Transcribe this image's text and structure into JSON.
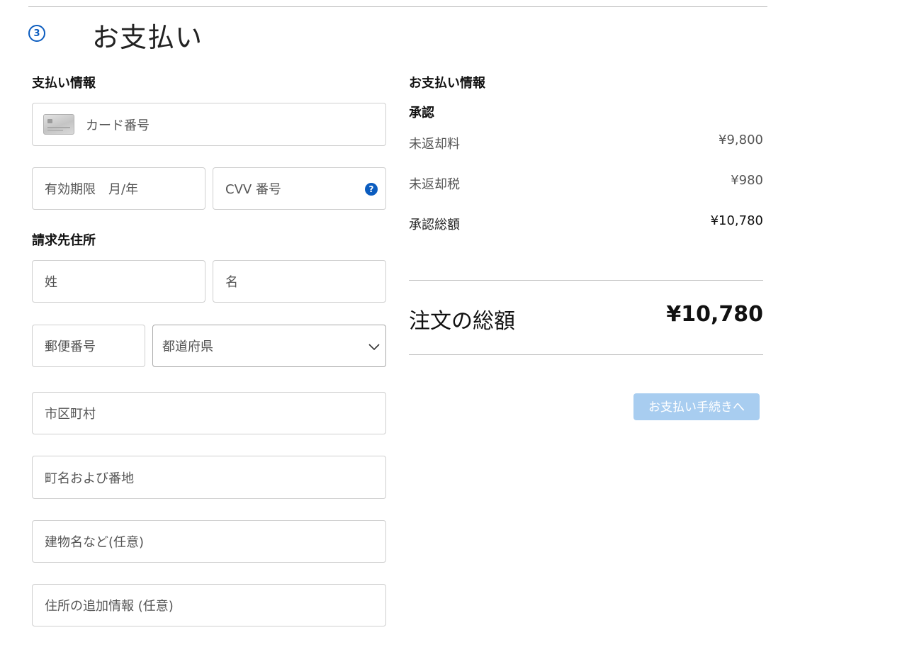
{
  "step": {
    "number": "3",
    "title": "お支払い"
  },
  "payment": {
    "heading": "支払い情報",
    "card_number_placeholder": "カード番号",
    "expiry_placeholder": "有効期限　月/年",
    "cvv_placeholder": "CVV 番号",
    "cvv_help": "?"
  },
  "billing": {
    "heading": "請求先住所",
    "last_name_placeholder": "姓",
    "first_name_placeholder": "名",
    "postal_code_placeholder": "郵便番号",
    "prefecture_selected": "都道府県",
    "city_placeholder": "市区町村",
    "street_placeholder": "町名および番地",
    "building_placeholder": "建物名など(任意)",
    "extra_placeholder": "住所の追加情報 (任意)"
  },
  "summary": {
    "heading": "お支払い情報",
    "subheading": "承認",
    "rows": [
      {
        "label": "未返却料",
        "value": "¥9,800"
      },
      {
        "label": "未返却税",
        "value": "¥980"
      },
      {
        "label": "承認総額",
        "value": "¥10,780"
      }
    ],
    "order_total_label": "注文の総額",
    "order_total_value": "¥10,780",
    "pay_button_label": "お支払い手続きへ"
  },
  "colors": {
    "accent": "#0b5cbf",
    "button_disabled": "#a8cdf0"
  }
}
